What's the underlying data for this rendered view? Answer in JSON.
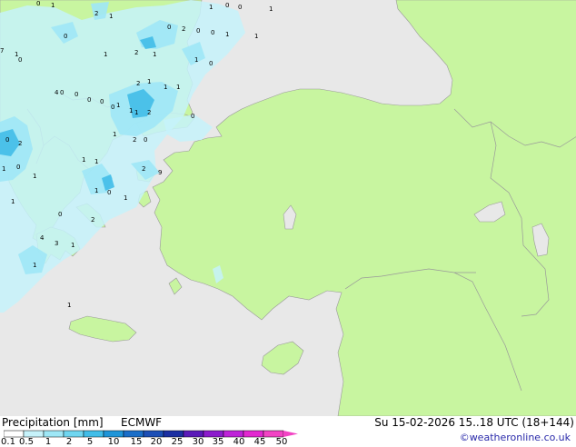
{
  "legend": {
    "label": "Precipitation [mm]",
    "model": "ECMWF",
    "ticks": [
      "0.1",
      "0.5",
      "1",
      "2",
      "5",
      "10",
      "15",
      "20",
      "25",
      "30",
      "35",
      "40",
      "45",
      "50"
    ],
    "colors": [
      "#ffffff",
      "#c6f2fa",
      "#9ee7f6",
      "#6fd6f0",
      "#41bde8",
      "#1f95d8",
      "#1a6ec8",
      "#1c4fb6",
      "#1b2fa2",
      "#5a1ab8",
      "#8c1ccc",
      "#be22d8",
      "#e228d0",
      "#f244c4"
    ]
  },
  "valid_time": "Su 15-02-2026 15..18 UTC (18+144)",
  "copyright": "©weatheronline.co.uk",
  "map_colors": {
    "sea": "#e8e8e8",
    "land": "#c8f5a0",
    "border": "#999999",
    "precip_light": "#c6f2fa",
    "precip_mid": "#9ee7f6",
    "precip_heavy": "#41bde8"
  },
  "point_values": [
    "0",
    "1",
    "2",
    "7",
    "1",
    "0",
    "0",
    "1",
    "1",
    "2",
    "1",
    "0",
    "0",
    "1",
    "2",
    "1",
    "1",
    "0",
    "0",
    "0",
    "0",
    "1",
    "1",
    "2",
    "1",
    "1",
    "1",
    "4",
    "0",
    "0",
    "0",
    "0",
    "1",
    "1",
    "1",
    "2",
    "1",
    "2",
    "0",
    "0",
    "2",
    "1",
    "0",
    "1",
    "1",
    "1",
    "1",
    "0",
    "1",
    "2",
    "9",
    "0",
    "1",
    "4",
    "3",
    "1",
    "2",
    "0",
    "1",
    "1",
    "0"
  ]
}
